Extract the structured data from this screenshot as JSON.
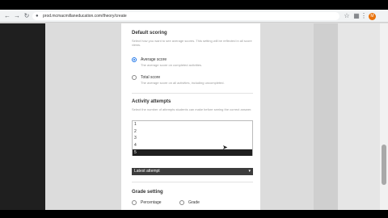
{
  "browser": {
    "url": "prod.mcmacmillaneducation.com/theory/create",
    "back_icon": "arrow-left-icon",
    "forward_icon": "arrow-right-icon",
    "reload_icon": "reload-icon",
    "profile_initial": "M"
  },
  "page": {
    "default_scoring": {
      "heading": "Default scoring",
      "description": "Select how you want to see average scores. This setting will be reflected in all score views.",
      "options": [
        {
          "label": "Average score",
          "sub": "The average score on completed activities.",
          "selected": true
        },
        {
          "label": "Total score",
          "sub": "The average score on all activities, including uncompleted.",
          "selected": false
        }
      ]
    },
    "activity_attempts": {
      "heading": "Activity attempts",
      "description": "Select the number of attempts students can make before seeing the correct answer.",
      "current_value": "2",
      "dropdown_options": [
        "1",
        "2",
        "3",
        "4",
        "5"
      ],
      "highlighted_option": "5",
      "second_select_value": "Latest attempt"
    },
    "grade_setting": {
      "heading": "Grade setting",
      "options": [
        {
          "label": "Percentage",
          "selected": false
        },
        {
          "label": "Grade",
          "selected": false
        }
      ]
    }
  }
}
